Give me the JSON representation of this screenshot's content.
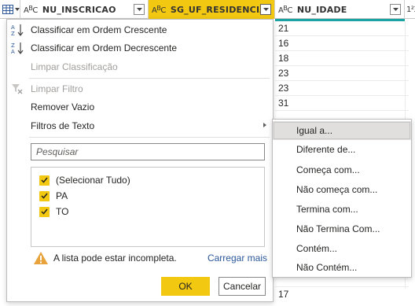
{
  "header": {
    "columns": [
      {
        "type_icon": "A",
        "type_sup": "B",
        "type_c": "C",
        "name": "NU_INSCRICAO"
      },
      {
        "type_icon": "A",
        "type_sup": "B",
        "type_c": "C",
        "name": "SG_UF_RESIDENCIA"
      },
      {
        "type_icon": "A",
        "type_sup": "B",
        "type_c": "C",
        "name": "NU_IDADE"
      },
      {
        "type_icon": "1²3"
      }
    ],
    "selected_column": "SG_UF_RESIDENCIA",
    "accent_color": "#f2c811"
  },
  "grid": {
    "idade_values": [
      "21",
      "16",
      "18",
      "23",
      "23",
      "31"
    ],
    "last_value": "17"
  },
  "menu": {
    "sort_asc": "Classificar em Ordem Crescente",
    "sort_desc": "Classificar em Ordem Decrescente",
    "clear_sort": "Limpar Classificação",
    "clear_filter": "Limpar Filtro",
    "remove_empty": "Remover Vazio",
    "text_filters": "Filtros de Texto",
    "icons": [
      "sort-ascending-icon",
      "sort-descending-icon",
      "clear-filter-icon"
    ]
  },
  "filter": {
    "search_placeholder": "Pesquisar",
    "items": [
      {
        "label": "(Selecionar Tudo)",
        "checked": true
      },
      {
        "label": "PA",
        "checked": true
      },
      {
        "label": "TO",
        "checked": true
      }
    ],
    "warning": "A lista pode estar incompleta.",
    "load_more": "Carregar mais",
    "ok": "OK",
    "cancel": "Cancelar"
  },
  "submenu": {
    "items": [
      "Igual a...",
      "Diferente de...",
      "Começa com...",
      "Não começa com...",
      "Termina com...",
      "Não Termina Com...",
      "Contém...",
      "Não Contém..."
    ],
    "highlighted": 0
  }
}
